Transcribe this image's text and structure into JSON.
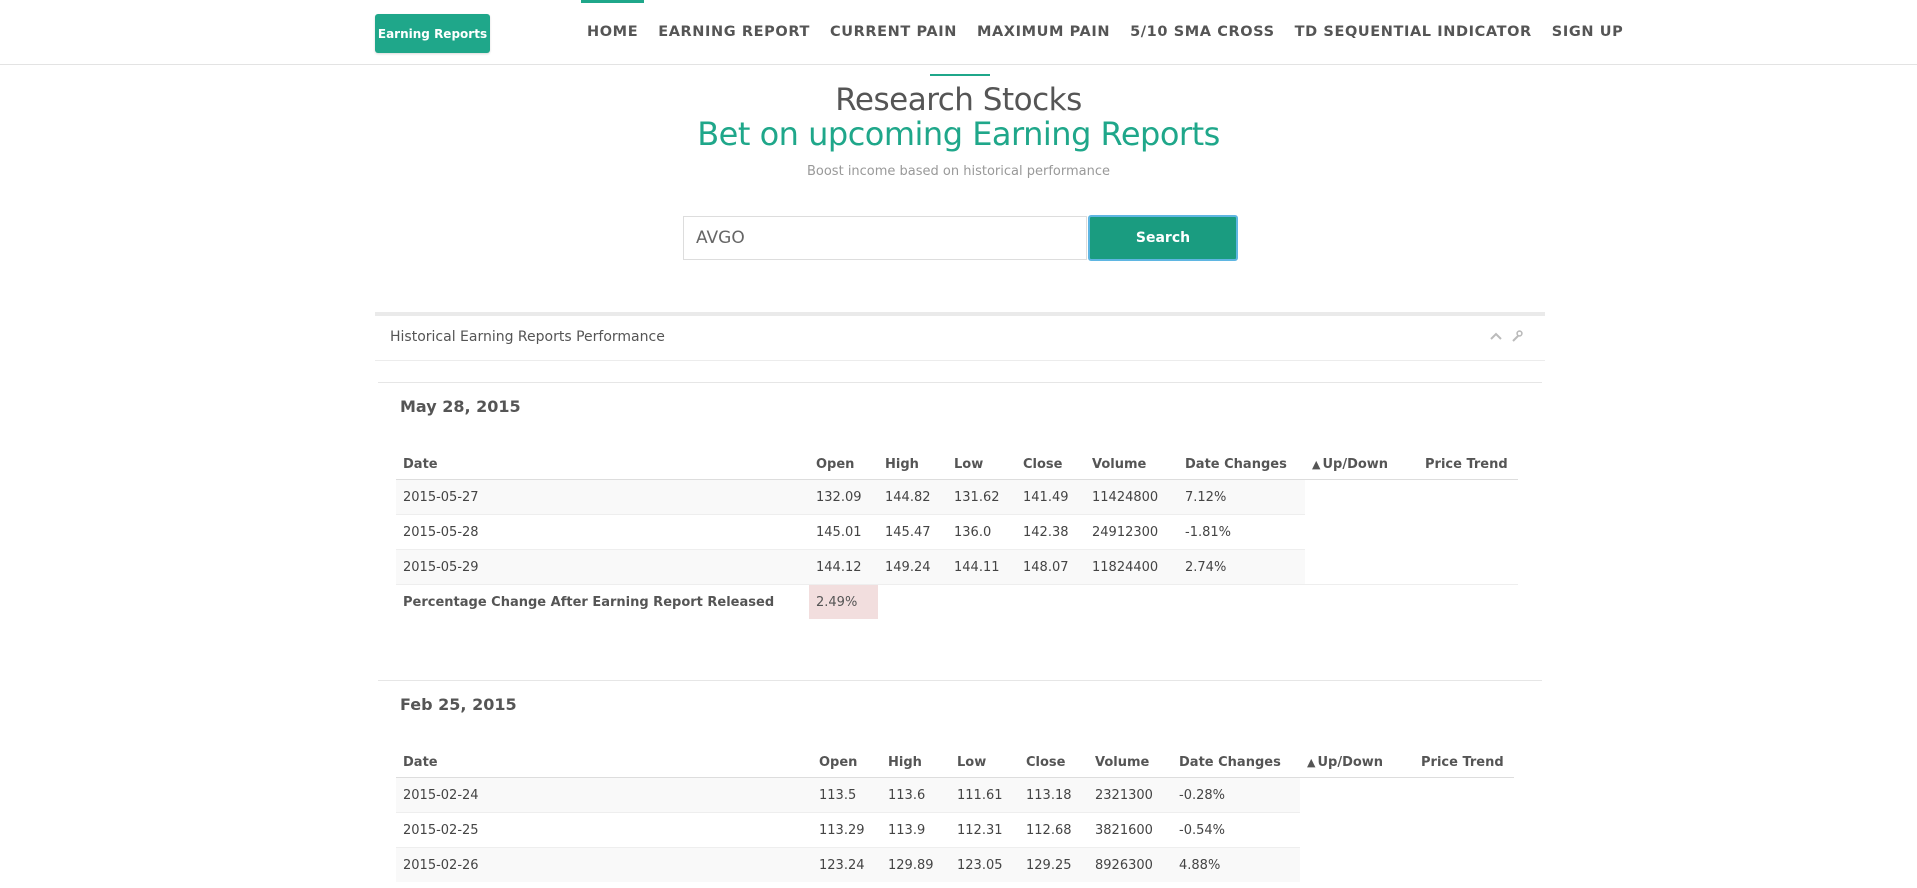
{
  "brand": "Earning Reports",
  "nav": {
    "items": [
      "HOME",
      "EARNING REPORT",
      "CURRENT PAIN",
      "MAXIMUM PAIN",
      "5/10 SMA CROSS",
      "TD SEQUENTIAL INDICATOR",
      "SIGN UP"
    ],
    "active": "HOME"
  },
  "hero": {
    "title": "Research Stocks",
    "subtitle": "Bet on upcoming Earning Reports",
    "tagline": "Boost income based on historical performance"
  },
  "search": {
    "value": "AVGO",
    "button_label": "Search"
  },
  "panel": {
    "title": "Historical Earning Reports Performance",
    "columns": [
      "Date",
      "Open",
      "High",
      "Low",
      "Close",
      "Volume",
      "Date Changes",
      "Up/Down",
      "Price Trend"
    ],
    "updown_symbol": "▲",
    "summary_label": "Percentage Change After Earning Report Released",
    "reports": [
      {
        "date": "May 28, 2015",
        "rows": [
          [
            "2015-05-27",
            "132.09",
            "144.82",
            "131.62",
            "141.49",
            "11424800",
            "7.12%"
          ],
          [
            "2015-05-28",
            "145.01",
            "145.47",
            "136.0",
            "142.38",
            "24912300",
            "-1.81%"
          ],
          [
            "2015-05-29",
            "144.12",
            "149.24",
            "144.11",
            "148.07",
            "11824400",
            "2.74%"
          ]
        ],
        "summary_value": "2.49%"
      },
      {
        "date": "Feb 25, 2015",
        "rows": [
          [
            "2015-02-24",
            "113.5",
            "113.6",
            "111.61",
            "113.18",
            "2321300",
            "-0.28%"
          ],
          [
            "2015-02-25",
            "113.29",
            "113.9",
            "112.31",
            "112.68",
            "3821600",
            "-0.54%"
          ],
          [
            "2015-02-26",
            "123.24",
            "129.89",
            "123.05",
            "129.25",
            "8926300",
            "4.88%"
          ]
        ]
      }
    ]
  },
  "colors": {
    "accent": "#1fa78a",
    "button": "#1a9c80",
    "summary_highlight": "#f2dede"
  }
}
